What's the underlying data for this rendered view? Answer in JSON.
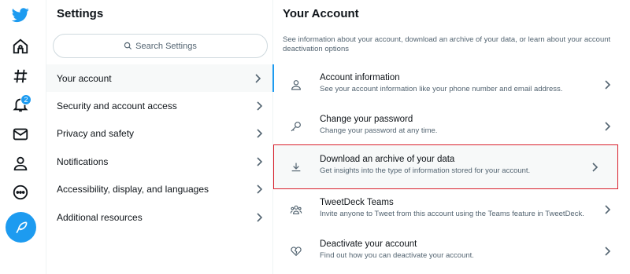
{
  "colors": {
    "accent": "#1d9bf0",
    "highlight_border": "#d91f2b",
    "text": "#0f1419",
    "muted": "#536471"
  },
  "rail": {
    "items": [
      {
        "name": "twitter-logo-icon"
      },
      {
        "name": "home-icon"
      },
      {
        "name": "explore-hashtag-icon"
      },
      {
        "name": "notifications-bell-icon",
        "badge": "2"
      },
      {
        "name": "messages-envelope-icon"
      },
      {
        "name": "profile-icon"
      },
      {
        "name": "more-icon"
      },
      {
        "name": "compose-tweet-icon"
      }
    ]
  },
  "settings": {
    "title": "Settings",
    "search_placeholder": "Search Settings",
    "items": [
      {
        "label": "Your account",
        "active": true
      },
      {
        "label": "Security and account access"
      },
      {
        "label": "Privacy and safety"
      },
      {
        "label": "Notifications"
      },
      {
        "label": "Accessibility, display, and languages"
      },
      {
        "label": "Additional resources"
      }
    ]
  },
  "account": {
    "title": "Your Account",
    "description": "See information about your account, download an archive of your data, or learn about your account deactivation options",
    "rows": [
      {
        "icon": "person-icon",
        "title": "Account information",
        "subtitle": "See your account information like your phone number and email address."
      },
      {
        "icon": "key-icon",
        "title": "Change your password",
        "subtitle": "Change your password at any time."
      },
      {
        "icon": "download-icon",
        "title": "Download an archive of your data",
        "subtitle": "Get insights into the type of information stored for your account.",
        "highlighted": true
      },
      {
        "icon": "teams-icon",
        "title": "TweetDeck Teams",
        "subtitle": "Invite anyone to Tweet from this account using the Teams feature in TweetDeck."
      },
      {
        "icon": "broken-heart-icon",
        "title": "Deactivate your account",
        "subtitle": "Find out how you can deactivate your account."
      }
    ]
  }
}
